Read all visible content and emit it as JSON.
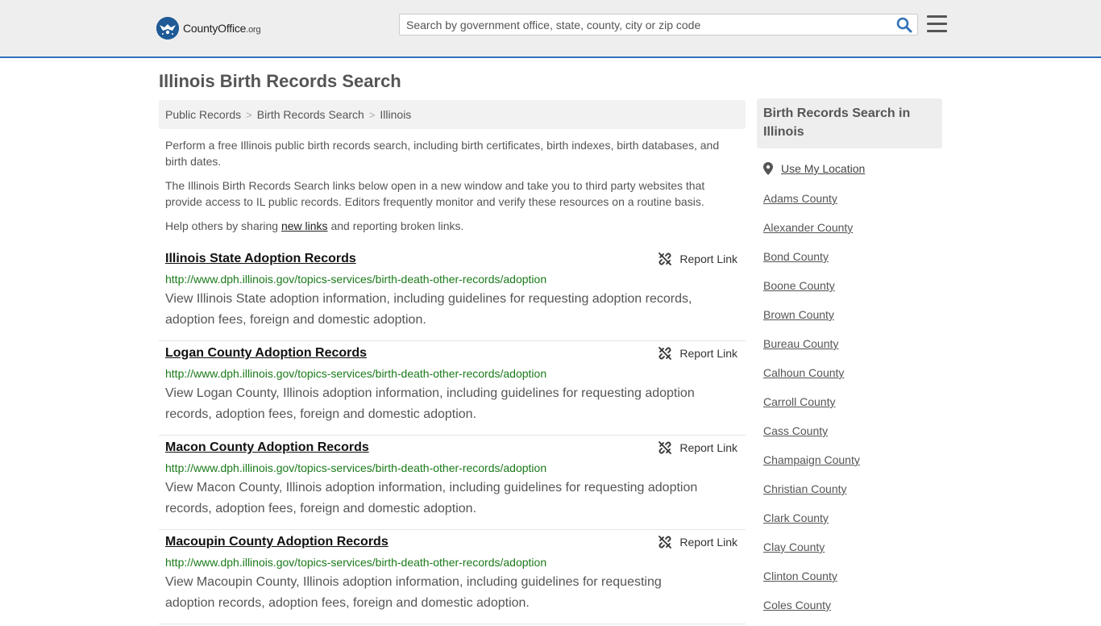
{
  "header": {
    "logo_text": "CountyOffice",
    "logo_suffix": ".org",
    "search_placeholder": "Search by government office, state, county, city or zip code"
  },
  "page_title": "Illinois Birth Records Search",
  "breadcrumb": [
    "Public Records",
    "Birth Records Search",
    "Illinois"
  ],
  "intro": {
    "p1": "Perform a free Illinois public birth records search, including birth certificates, birth indexes, birth databases, and birth dates.",
    "p2": "The Illinois Birth Records Search links below open in a new window and take you to third party websites that provide access to IL public records. Editors frequently monitor and verify these resources on a routine basis.",
    "p3_before": "Help others by sharing ",
    "p3_link": "new links",
    "p3_after": " and reporting broken links."
  },
  "report_label": "Report Link",
  "results": [
    {
      "title": "Illinois State Adoption Records",
      "url": "http://www.dph.illinois.gov/topics-services/birth-death-other-records/adoption",
      "desc": "View Illinois State adoption information, including guidelines for requesting adoption records, adoption fees, foreign and domestic adoption."
    },
    {
      "title": "Logan County Adoption Records",
      "url": "http://www.dph.illinois.gov/topics-services/birth-death-other-records/adoption",
      "desc": "View Logan County, Illinois adoption information, including guidelines for requesting adoption records, adoption fees, foreign and domestic adoption."
    },
    {
      "title": "Macon County Adoption Records",
      "url": "http://www.dph.illinois.gov/topics-services/birth-death-other-records/adoption",
      "desc": "View Macon County, Illinois adoption information, including guidelines for requesting adoption records, adoption fees, foreign and domestic adoption."
    },
    {
      "title": "Macoupin County Adoption Records",
      "url": "http://www.dph.illinois.gov/topics-services/birth-death-other-records/adoption",
      "desc": "View Macoupin County, Illinois adoption information, including guidelines for requesting adoption records, adoption fees, foreign and domestic adoption."
    }
  ],
  "sidebar": {
    "heading": "Birth Records Search in Illinois",
    "location_label": "Use My Location",
    "counties": [
      "Adams County",
      "Alexander County",
      "Bond County",
      "Boone County",
      "Brown County",
      "Bureau County",
      "Calhoun County",
      "Carroll County",
      "Cass County",
      "Champaign County",
      "Christian County",
      "Clark County",
      "Clay County",
      "Clinton County",
      "Coles County"
    ]
  },
  "colors": {
    "accent": "#2f72b8",
    "url_green": "#1a7a1a",
    "header_bg": "#eeeeee"
  }
}
